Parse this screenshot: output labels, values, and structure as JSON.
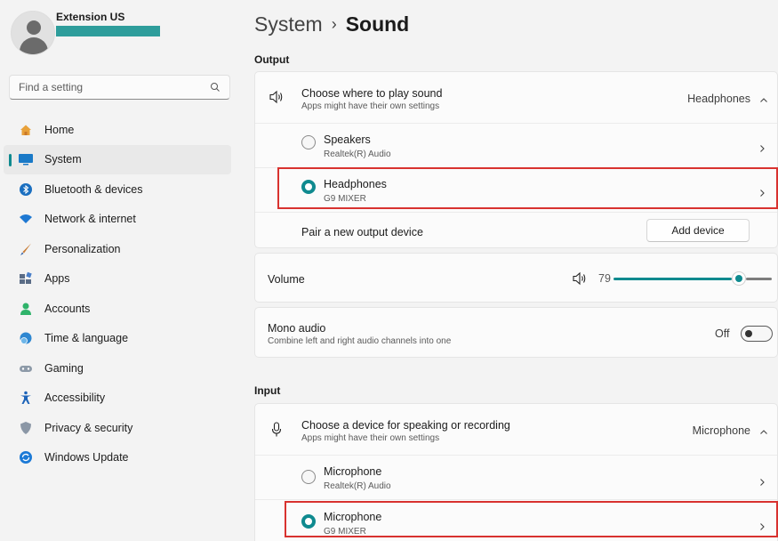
{
  "user": {
    "name": "Extension US"
  },
  "search": {
    "placeholder": "Find a setting"
  },
  "nav": {
    "items": [
      {
        "label": "Home",
        "icon": "home-icon"
      },
      {
        "label": "System",
        "icon": "system-icon",
        "active": true
      },
      {
        "label": "Bluetooth & devices",
        "icon": "bluetooth-icon"
      },
      {
        "label": "Network & internet",
        "icon": "wifi-icon"
      },
      {
        "label": "Personalization",
        "icon": "brush-icon"
      },
      {
        "label": "Apps",
        "icon": "apps-icon"
      },
      {
        "label": "Accounts",
        "icon": "person-icon"
      },
      {
        "label": "Time & language",
        "icon": "globe-clock-icon"
      },
      {
        "label": "Gaming",
        "icon": "gamepad-icon"
      },
      {
        "label": "Accessibility",
        "icon": "accessibility-icon"
      },
      {
        "label": "Privacy & security",
        "icon": "shield-icon"
      },
      {
        "label": "Windows Update",
        "icon": "update-icon"
      }
    ]
  },
  "breadcrumb": {
    "parent": "System",
    "separator": "›",
    "current": "Sound"
  },
  "output": {
    "section_label": "Output",
    "choose": {
      "title": "Choose where to play sound",
      "subtitle": "Apps might have their own settings",
      "value": "Headphones"
    },
    "devices": [
      {
        "name": "Speakers",
        "detail": "Realtek(R) Audio",
        "selected": false
      },
      {
        "name": "Headphones",
        "detail": "G9 MIXER",
        "selected": true
      }
    ],
    "pair": {
      "label": "Pair a new output device",
      "button": "Add device"
    }
  },
  "volume": {
    "label": "Volume",
    "value": "79",
    "level": 0.79
  },
  "mono": {
    "title": "Mono audio",
    "subtitle": "Combine left and right audio channels into one",
    "state": "Off"
  },
  "input": {
    "section_label": "Input",
    "choose": {
      "title": "Choose a device for speaking or recording",
      "subtitle": "Apps might have their own settings",
      "value": "Microphone"
    },
    "devices": [
      {
        "name": "Microphone",
        "detail": "Realtek(R) Audio",
        "selected": false
      },
      {
        "name": "Microphone",
        "detail": "G9 MIXER",
        "selected": true
      }
    ]
  },
  "colors": {
    "accent": "#0f8a8f",
    "highlight": "#d8322f",
    "profile_bar": "#2e9d9b"
  }
}
